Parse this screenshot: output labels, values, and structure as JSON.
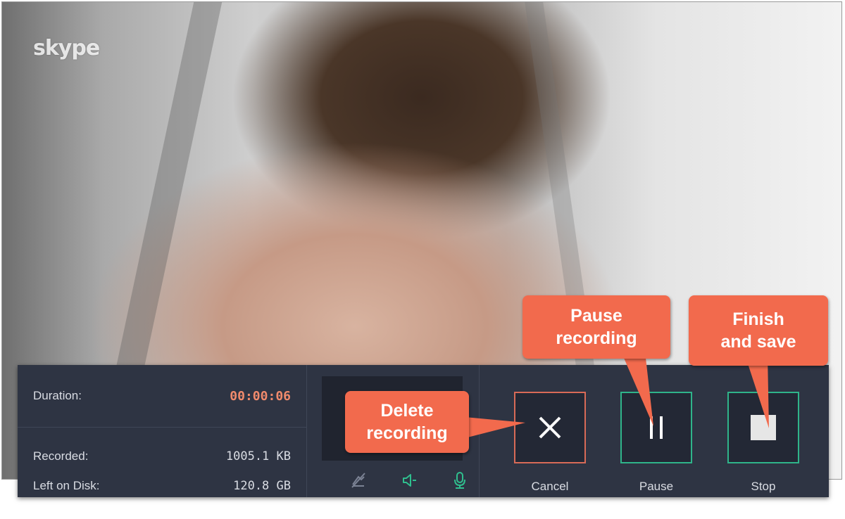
{
  "video": {
    "logo_text": "skype"
  },
  "recorder": {
    "stats": [
      {
        "label": "Duration:",
        "value": "00:00:06"
      },
      {
        "label": "Recorded:",
        "value": "1005.1 KB"
      },
      {
        "label": "Left on Disk:",
        "value": "120.8 GB"
      }
    ],
    "io_icons": [
      "webcam-off-icon",
      "speaker-icon",
      "microphone-icon"
    ],
    "buttons": {
      "cancel_label": "Cancel",
      "pause_label": "Pause",
      "stop_label": "Stop"
    }
  },
  "callouts": {
    "delete": [
      "Delete",
      "recording"
    ],
    "pause": [
      "Pause",
      "recording"
    ],
    "finish": [
      "Finish",
      "and save"
    ]
  },
  "colors": {
    "panel": "#2e3443",
    "accent_red": "#f26a4d",
    "cancel_border": "#d86a57",
    "green_border": "#2fb48a",
    "duration_text": "#f08a6c",
    "icon_green": "#2fbf8e"
  }
}
